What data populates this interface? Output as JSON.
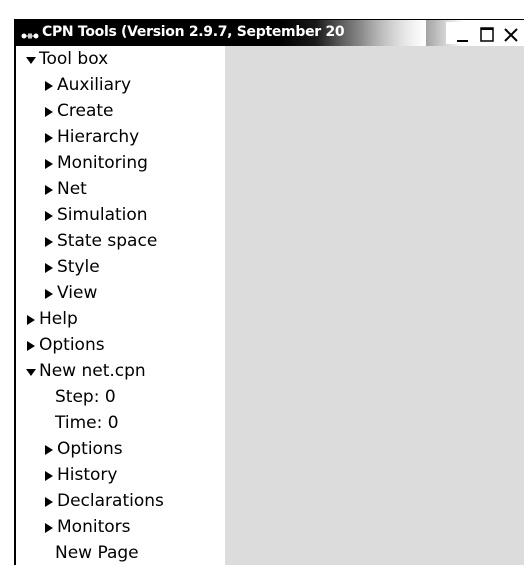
{
  "window": {
    "title": "CPN Tools (Version 2.9.7, September 20"
  },
  "controls": {
    "minimize": "minimize-icon",
    "maximize": "maximize-icon",
    "close": "close-icon"
  },
  "tree": {
    "toolbox": {
      "label": "Tool box",
      "expanded": true,
      "children": [
        "Auxiliary",
        "Create",
        "Hierarchy",
        "Monitoring",
        "Net",
        "Simulation",
        "State space",
        "Style",
        "View"
      ]
    },
    "help": {
      "label": "Help",
      "expanded": false
    },
    "options": {
      "label": "Options",
      "expanded": false
    },
    "net": {
      "label": "New net.cpn",
      "expanded": true,
      "step": "Step: 0",
      "time": "Time: 0",
      "children": [
        "Options",
        "History",
        "Declarations",
        "Monitors"
      ],
      "page": "New Page"
    }
  },
  "colors": {
    "canvas": "#dcdcdc",
    "titlebar": "#000000"
  }
}
